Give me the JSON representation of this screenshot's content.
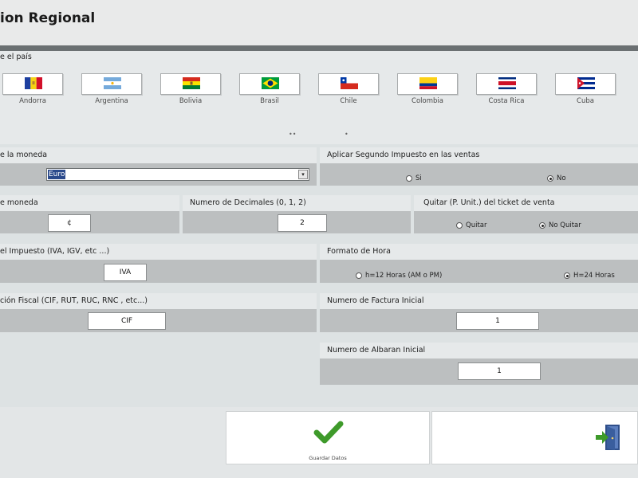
{
  "window": {
    "title": "ion Regional"
  },
  "country_section": {
    "label": "e el país",
    "countries": [
      {
        "name": "Andorra"
      },
      {
        "name": "Argentina"
      },
      {
        "name": "Bolivia"
      },
      {
        "name": "Brasil"
      },
      {
        "name": "Chile"
      },
      {
        "name": "Colombia"
      },
      {
        "name": "Costa Rica"
      },
      {
        "name": "Cuba"
      }
    ],
    "page_indicator_1": "••",
    "page_indicator_2": "•"
  },
  "currency": {
    "label": "e la moneda",
    "selected": "Euro",
    "arrow": "▾"
  },
  "second_tax": {
    "label": "Aplicar Segundo Impuesto en las ventas",
    "options": [
      "Si",
      "No"
    ],
    "selected": "No"
  },
  "currency_symbol": {
    "label": "e moneda",
    "value": "¢"
  },
  "decimals": {
    "label": "Numero de Decimales (0, 1, 2)",
    "value": "2"
  },
  "ticket_price": {
    "label": "Quitar (P. Unit.) del ticket de venta",
    "options": [
      "Quitar",
      "No Quitar"
    ],
    "selected": "No Quitar"
  },
  "tax_name": {
    "label": "el Impuesto (IVA, IGV, etc ...)",
    "value": "IVA"
  },
  "time_format": {
    "label": "Formato de Hora",
    "options": [
      "h=12 Horas (AM o PM)",
      "H=24 Horas"
    ],
    "selected": "H=24 Horas"
  },
  "fiscal_id": {
    "label": "ción Fiscal (CIF, RUT, RUC, RNC , etc...)",
    "value": "CIF"
  },
  "invoice_start": {
    "label": "Numero de Factura Inicial",
    "value": "1"
  },
  "delivery_start": {
    "label": "Numero de Albaran Inicial",
    "value": "1"
  },
  "footer": {
    "save_label": "Guardar Datos",
    "save_icon": "checkmark-icon",
    "exit_icon": "exit-door-icon"
  },
  "colors": {
    "accent_green": "#3e9a2a",
    "panel_header": "#e6e9ea",
    "panel_body": "#bcbfc0"
  }
}
